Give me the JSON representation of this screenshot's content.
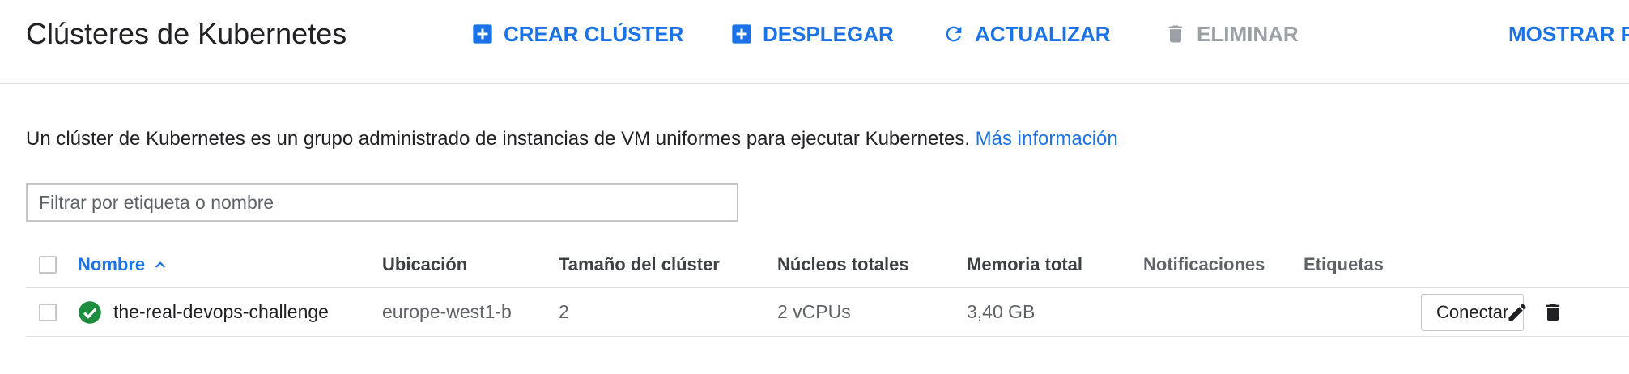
{
  "header": {
    "title": "Clústeres de Kubernetes",
    "actions": [
      {
        "label": "CREAR CLÚSTER",
        "icon": "add-box-icon",
        "enabled": true
      },
      {
        "label": "DESPLEGAR",
        "icon": "add-box-icon",
        "enabled": true
      },
      {
        "label": "ACTUALIZAR",
        "icon": "refresh-icon",
        "enabled": true
      },
      {
        "label": "ELIMINAR",
        "icon": "trash-icon",
        "enabled": false
      },
      {
        "label": "MOSTRAR P",
        "icon": "",
        "enabled": true
      }
    ]
  },
  "description": {
    "text": "Un clúster de Kubernetes es un grupo administrado de instancias de VM uniformes para ejecutar Kubernetes. ",
    "link": "Más información"
  },
  "filter": {
    "placeholder": "Filtrar por etiqueta o nombre",
    "value": ""
  },
  "table": {
    "columns": {
      "name": "Nombre",
      "location": "Ubicación",
      "size": "Tamaño del clúster",
      "cores": "Núcleos totales",
      "memory": "Memoria total",
      "notifications": "Notificaciones",
      "labels": "Etiquetas"
    },
    "sort": {
      "column": "name",
      "direction": "ascending",
      "icon": "chevron-up-icon"
    },
    "rows": [
      {
        "status": "ok",
        "status_icon": "check-circle-icon",
        "name": "the-real-devops-challenge",
        "location": "europe-west1-b",
        "size": "2",
        "cores": "2 vCPUs",
        "memory": "3,40 GB",
        "notifications": "",
        "labels": "",
        "connect_label": "Conectar",
        "row_icons": [
          "edit-icon",
          "trash-icon"
        ]
      }
    ]
  },
  "colors": {
    "accent": "#1a73e8",
    "disabled": "#9aa0a6",
    "success": "#1e8e3e",
    "text": "#202124",
    "muted": "#5f6368",
    "divider": "#dadce0"
  }
}
